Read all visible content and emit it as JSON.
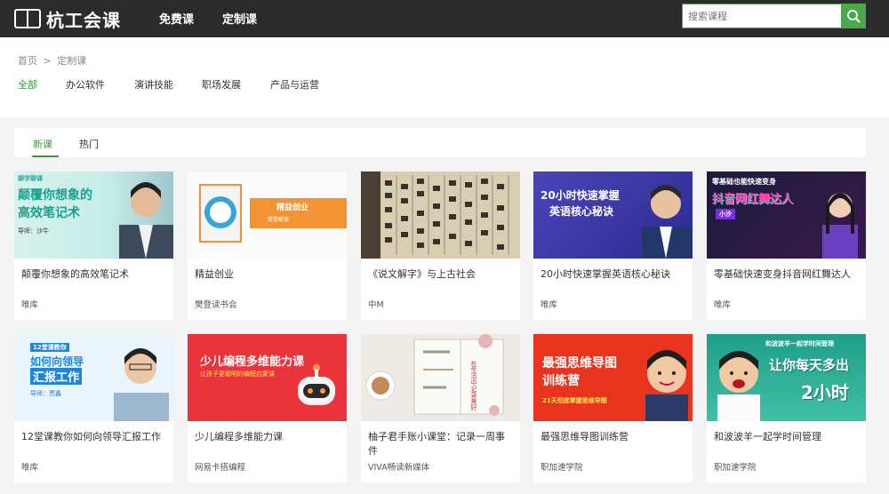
{
  "header": {
    "logo_text": "杭工会课",
    "nav": [
      "免费课",
      "定制课"
    ],
    "search_placeholder": "搜索课程"
  },
  "breadcrumb": {
    "home": "首页",
    "separator": ">",
    "current": "定制课"
  },
  "categories": [
    "全部",
    "办公软件",
    "演讲技能",
    "职场发展",
    "产品与运营"
  ],
  "tabs": [
    "新课",
    "热门"
  ],
  "courses": [
    {
      "title": "颠覆你想象的高效笔记术",
      "org": "唯库",
      "thumb_lines": [
        "颠覆你想象的",
        "高效笔记术"
      ],
      "thumb_tag": "聊学聊课",
      "thumb_author": "导师：沙牛"
    },
    {
      "title": "精益创业",
      "org": "樊登读书会",
      "thumb_lines": [
        "精益创业"
      ],
      "thumb_sub": "樊登解读"
    },
    {
      "title": "《说文解字》与上古社会",
      "org": "中M"
    },
    {
      "title": "20小时快速掌握英语核心秘诀",
      "org": "唯库",
      "thumb_lines": [
        "20小时快速掌握",
        "英语核心秘诀"
      ]
    },
    {
      "title": "零基础快速变身抖音网红舞达人",
      "org": "唯库",
      "thumb_lines": [
        "零基础也能快速变身",
        "抖音网红舞达人"
      ],
      "thumb_tag": "小汐"
    },
    {
      "title": "12堂课教你如何向领导汇报工作",
      "org": "唯库",
      "thumb_lines": [
        "12堂课教你",
        "如何向领导",
        "汇报工作"
      ],
      "thumb_author": "导师：贾鑫"
    },
    {
      "title": "少儿编程多维能力课",
      "org": "网易卡搭编程",
      "thumb_lines": [
        "少儿编程多维能力课",
        "让孩子更聪明的编程启蒙课"
      ]
    },
    {
      "title": "柚子君手账小课堂：记录一周事件",
      "org": "VIVA畅读新媒体",
      "thumb_lines": [
        "在生活中记录美好"
      ]
    },
    {
      "title": "最强思维导图训练营",
      "org": "职加速学院",
      "thumb_lines": [
        "最强思维导图",
        "训练营",
        "21天彻底掌握思维导图"
      ]
    },
    {
      "title": "和波波羊一起学时间管理",
      "org": "职加速学院",
      "thumb_lines": [
        "和波波羊一起学时间管理",
        "让你每天多出",
        "2小时"
      ]
    }
  ],
  "colors": {
    "accent": "#3a9a3d",
    "header_bg": "#2b2b2b"
  }
}
